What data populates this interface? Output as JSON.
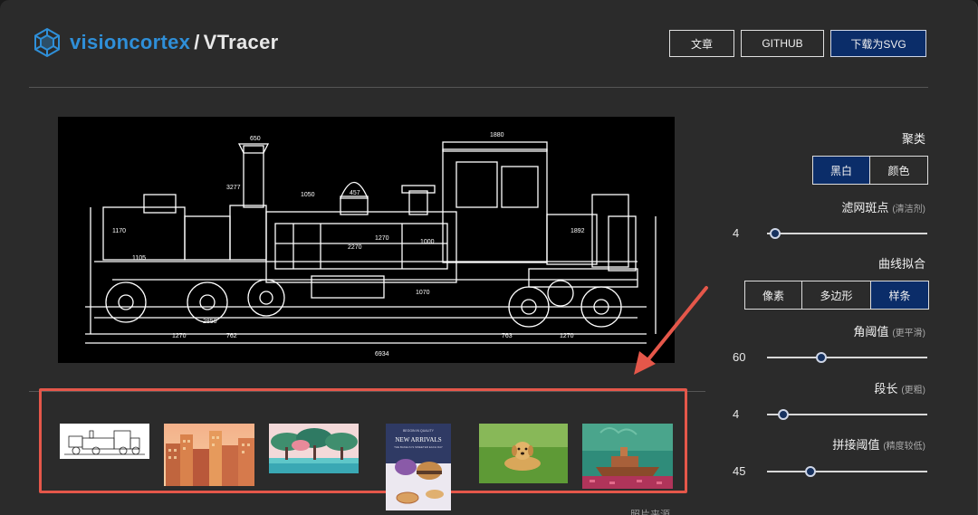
{
  "header": {
    "brand_primary": "visioncortex",
    "separator": "/",
    "brand_secondary": "VTracer",
    "buttons": {
      "article": "文章",
      "github": "GITHUB",
      "download": "下载为SVG"
    }
  },
  "controls": {
    "clustering": {
      "label": "聚类",
      "options": [
        "黑白",
        "颜色"
      ],
      "selected": "黑白"
    },
    "filter_speckle": {
      "label": "滤网斑点",
      "hint": "(清洁剂)",
      "value": "4",
      "fraction": 0.05
    },
    "curve_fitting": {
      "label": "曲线拟合",
      "options": [
        "像素",
        "多边形",
        "样条"
      ],
      "selected": "样条"
    },
    "corner_threshold": {
      "label": "角阈值",
      "hint": "(更平滑)",
      "value": "60",
      "fraction": 0.34
    },
    "segment_length": {
      "label": "段长",
      "hint": "(更粗)",
      "value": "4",
      "fraction": 0.1
    },
    "splice_threshold": {
      "label": "拼接阈值",
      "hint": "(精度较低)",
      "value": "45",
      "fraction": 0.27
    }
  },
  "gallery": {
    "items": [
      "locomotive-drawing",
      "city-buildings",
      "trees-landscape",
      "new-arrivals-poster",
      "golden-retriever",
      "ship-illustration"
    ],
    "poster": {
      "kicker": "BEGGIN IN QUALITY",
      "title": "NEW ARRIVALS",
      "subtitle": "THE BAKELS IS SWEETER EACH DAY"
    },
    "credit": "照片来源"
  },
  "preview": {
    "labels": [
      "1880",
      "1270",
      "650",
      "3277",
      "1050",
      "457",
      "2270",
      "1000",
      "1070",
      "1105",
      "6934",
      "762",
      "1270",
      "763",
      "1270",
      "1892",
      "1170",
      "2850"
    ]
  },
  "colors": {
    "accent": "#0b2d69",
    "annotation": "#e5574a",
    "brand": "#2f8fd8"
  }
}
